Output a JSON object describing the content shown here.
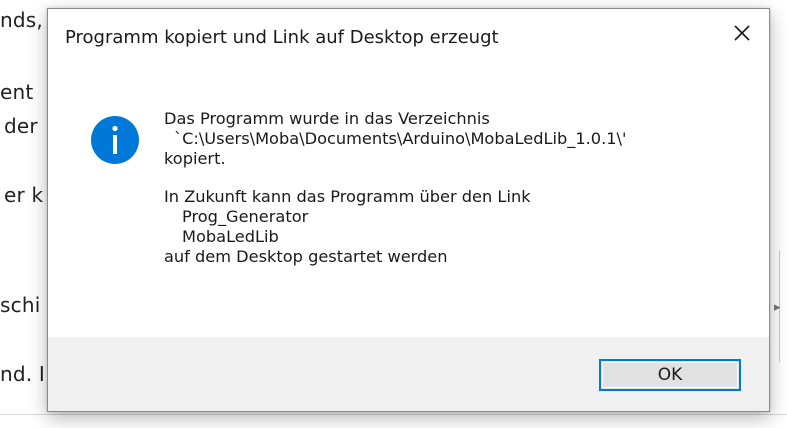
{
  "background": {
    "fragments": [
      "nds,",
      "ent",
      "der",
      "er k",
      "schi",
      "nd. I"
    ]
  },
  "dialog": {
    "title": "Programm kopiert und Link auf Desktop erzeugt",
    "close_icon": "close-icon",
    "info_icon": "info-icon",
    "message": {
      "line1": "Das Programm wurde in das Verzeichnis",
      "line2": "`C:\\Users\\Moba\\Documents\\Arduino\\MobaLedLib_1.0.1\\'",
      "line3": "kopiert.",
      "line4": "In Zukunft kann das Programm über den Link",
      "line5": "Prog_Generator",
      "line6": "MobaLedLib",
      "line7": "auf dem Desktop gestartet werden"
    },
    "ok_label": "OK"
  },
  "colors": {
    "accent": "#0078d7",
    "footer_bg": "#f0f0f0",
    "button_bg": "#e1e1e1"
  }
}
